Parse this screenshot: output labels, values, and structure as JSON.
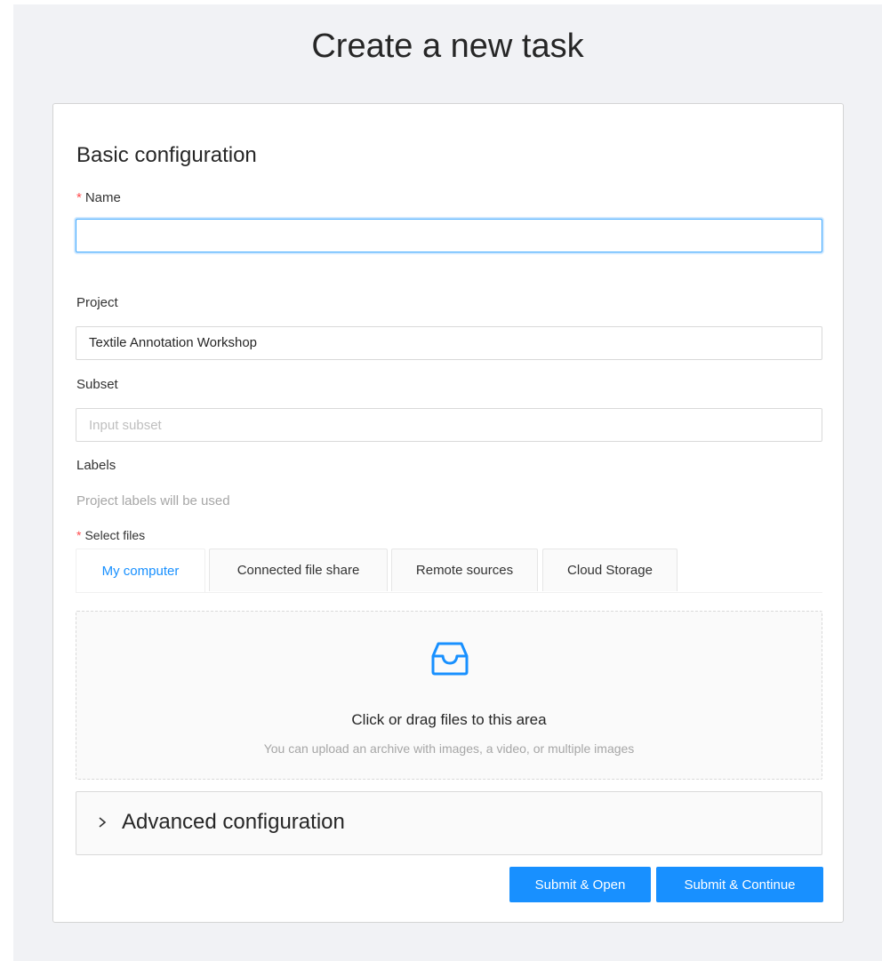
{
  "page": {
    "title": "Create a new task"
  },
  "basic": {
    "section_title": "Basic configuration",
    "name_label": "Name",
    "name_value": "",
    "name_placeholder": "",
    "project_label": "Project",
    "project_value": "Textile Annotation Workshop",
    "subset_label": "Subset",
    "subset_placeholder": "Input subset",
    "labels_label": "Labels",
    "labels_hint": "Project labels will be used",
    "files_label": "Select files",
    "required_mark": "*"
  },
  "tabs": [
    {
      "label": "My computer",
      "active": true
    },
    {
      "label": "Connected file share",
      "active": false
    },
    {
      "label": "Remote sources",
      "active": false
    },
    {
      "label": "Cloud Storage",
      "active": false
    }
  ],
  "dropzone": {
    "icon": "inbox-icon",
    "text": "Click or drag files to this area",
    "hint": "You can upload an archive with images, a video, or multiple images"
  },
  "advanced": {
    "icon": "chevron-right-icon",
    "title": "Advanced configuration"
  },
  "actions": {
    "submit_open_label": "Submit & Open",
    "submit_continue_label": "Submit & Continue"
  },
  "colors": {
    "primary": "#1890ff",
    "required": "#ff4d4f",
    "page_background": "#f1f2f5"
  }
}
